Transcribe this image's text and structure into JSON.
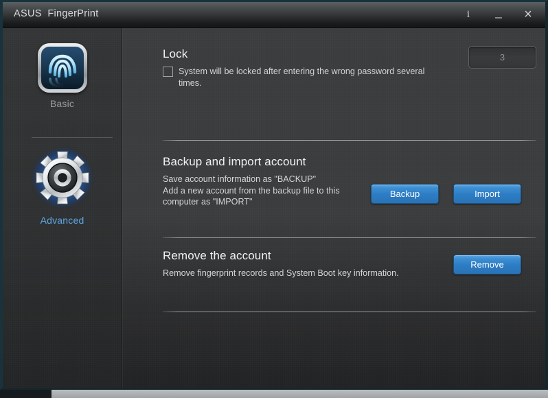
{
  "window": {
    "title": "ASUS  FingerPrint",
    "controls": {
      "info": "i",
      "minimize": "_",
      "close": "×"
    }
  },
  "sidebar": {
    "items": [
      {
        "id": "basic",
        "label": "Basic",
        "icon": "fingerprint-icon",
        "active": false
      },
      {
        "id": "advanced",
        "label": "Advanced",
        "icon": "gear-icon",
        "active": true
      }
    ]
  },
  "content": {
    "sections": [
      {
        "id": "lock",
        "title": "Lock",
        "description": "System will be locked after entering the wrong password several times.",
        "checkbox_checked": false,
        "count_value": "3"
      },
      {
        "id": "backup",
        "title": "Backup and import account",
        "description": "Save account information as \"BACKUP\"\nAdd a new account from the backup file to this computer as \"IMPORT\"",
        "description_line1": "Save account information as \"BACKUP\"",
        "description_line2": "Add a new account from the backup file to this",
        "description_line3": "computer as \"IMPORT\"",
        "buttons": [
          {
            "id": "backup",
            "label": "Backup"
          },
          {
            "id": "import",
            "label": "Import"
          }
        ]
      },
      {
        "id": "remove",
        "title": "Remove the account",
        "description": "Remove fingerprint records and System Boot key information.",
        "buttons": [
          {
            "id": "remove",
            "label": "Remove"
          }
        ]
      }
    ]
  },
  "colors": {
    "accent_blue": "#3d8ed2",
    "active_label": "#5fa8e8",
    "window_bg": "#3a3c3d",
    "sidebar_bg": "#2e3031",
    "border_teal": "#19333d",
    "text_primary": "#f0f2f3",
    "text_secondary": "#d2d5d7"
  }
}
